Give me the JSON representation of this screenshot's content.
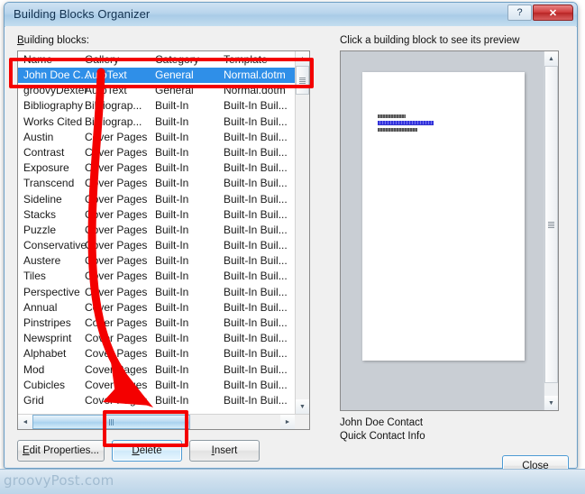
{
  "window": {
    "title": "Building Blocks Organizer",
    "help_button": "?",
    "close_button": "✕"
  },
  "left_panel": {
    "label": "Building blocks:",
    "columns": [
      "Name",
      "Gallery",
      "Category",
      "Template"
    ],
    "rows": [
      {
        "name": "John Doe C...",
        "gallery": "AutoText",
        "category": "General",
        "template": "Normal.dotm",
        "selected": true
      },
      {
        "name": "groovyDexter",
        "gallery": "AutoText",
        "category": "General",
        "template": "Normal.dotm",
        "selected": false
      },
      {
        "name": "Bibliography",
        "gallery": "Bibliograp...",
        "category": "Built-In",
        "template": "Built-In Buil...",
        "selected": false
      },
      {
        "name": "Works Cited",
        "gallery": "Bibliograp...",
        "category": "Built-In",
        "template": "Built-In Buil...",
        "selected": false
      },
      {
        "name": "Austin",
        "gallery": "Cover Pages",
        "category": "Built-In",
        "template": "Built-In Buil...",
        "selected": false
      },
      {
        "name": "Contrast",
        "gallery": "Cover Pages",
        "category": "Built-In",
        "template": "Built-In Buil...",
        "selected": false
      },
      {
        "name": "Exposure",
        "gallery": "Cover Pages",
        "category": "Built-In",
        "template": "Built-In Buil...",
        "selected": false
      },
      {
        "name": "Transcend",
        "gallery": "Cover Pages",
        "category": "Built-In",
        "template": "Built-In Buil...",
        "selected": false
      },
      {
        "name": "Sideline",
        "gallery": "Cover Pages",
        "category": "Built-In",
        "template": "Built-In Buil...",
        "selected": false
      },
      {
        "name": "Stacks",
        "gallery": "Cover Pages",
        "category": "Built-In",
        "template": "Built-In Buil...",
        "selected": false
      },
      {
        "name": "Puzzle",
        "gallery": "Cover Pages",
        "category": "Built-In",
        "template": "Built-In Buil...",
        "selected": false
      },
      {
        "name": "Conservative",
        "gallery": "Cover Pages",
        "category": "Built-In",
        "template": "Built-In Buil...",
        "selected": false
      },
      {
        "name": "Austere",
        "gallery": "Cover Pages",
        "category": "Built-In",
        "template": "Built-In Buil...",
        "selected": false
      },
      {
        "name": "Tiles",
        "gallery": "Cover Pages",
        "category": "Built-In",
        "template": "Built-In Buil...",
        "selected": false
      },
      {
        "name": "Perspective",
        "gallery": "Cover Pages",
        "category": "Built-In",
        "template": "Built-In Buil...",
        "selected": false
      },
      {
        "name": "Annual",
        "gallery": "Cover Pages",
        "category": "Built-In",
        "template": "Built-In Buil...",
        "selected": false
      },
      {
        "name": "Pinstripes",
        "gallery": "Cover Pages",
        "category": "Built-In",
        "template": "Built-In Buil...",
        "selected": false
      },
      {
        "name": "Newsprint",
        "gallery": "Cover Pages",
        "category": "Built-In",
        "template": "Built-In Buil...",
        "selected": false
      },
      {
        "name": "Alphabet",
        "gallery": "Cover Pages",
        "category": "Built-In",
        "template": "Built-In Buil...",
        "selected": false
      },
      {
        "name": "Mod",
        "gallery": "Cover Pages",
        "category": "Built-In",
        "template": "Built-In Buil...",
        "selected": false
      },
      {
        "name": "Cubicles",
        "gallery": "Cover Pages",
        "category": "Built-In",
        "template": "Built-In Buil...",
        "selected": false
      },
      {
        "name": "Grid",
        "gallery": "Cover Pages",
        "category": "Built-In",
        "template": "Built-In Buil...",
        "selected": false
      }
    ],
    "scroll_up_icon": "▲",
    "scroll_down_icon": "▼",
    "scroll_left_icon": "◄",
    "scroll_right_icon": "►"
  },
  "buttons": {
    "edit_properties": "Edit Properties...",
    "delete": "Delete",
    "insert": "Insert",
    "close": "Close"
  },
  "preview": {
    "label": "Click a building block to see its preview",
    "caption_title": "John Doe Contact",
    "caption_subtitle": "Quick Contact Info",
    "scroll_up_icon": "▲",
    "scroll_down_icon": "▼"
  },
  "annotations": {
    "highlight_color": "#f40000",
    "selected_row_box": "selected-row-highlight",
    "delete_button_box": "delete-button-highlight",
    "arrow": "arrow-pointing-to-delete"
  },
  "watermark": {
    "text": "groovyPost.com"
  }
}
